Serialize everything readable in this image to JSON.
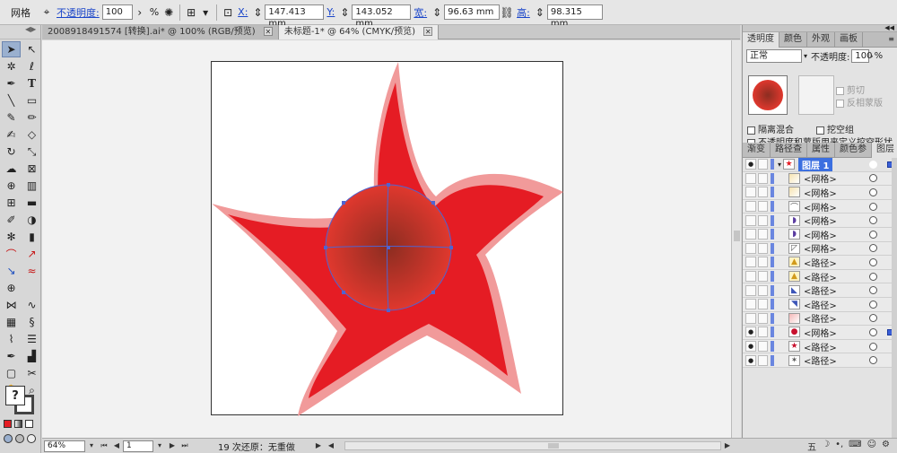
{
  "colors": {
    "star_outer": "#f19a9a",
    "star_inner": "#e51c24",
    "radial_center": "#8c2d21",
    "radial_edge": "#e0382e",
    "selection": "#5063d0",
    "layer_highlight": "#3b6fe0"
  },
  "control_bar": {
    "tool_name": "网格",
    "opacity_label": "不透明度:",
    "opacity_value": "100",
    "opacity_unit": "%",
    "x_label": "X:",
    "x_value": "147.413 mm",
    "y_label": "Y:",
    "y_value": "143.052 mm",
    "w_label": "宽:",
    "w_value": "96.63 mm",
    "h_label": "高:",
    "h_value": "98.315 mm"
  },
  "doc_tabs": [
    {
      "label": "2008918491574 [转换].ai* @ 100% (RGB/预览)",
      "active": false
    },
    {
      "label": "未标题-1* @ 64% (CMYK/预览)",
      "active": true
    }
  ],
  "tools": [
    "selection-tool",
    "direct-select-tool",
    "magic-wand-tool",
    "lasso-tool",
    "pen-tool",
    "type-tool",
    "line-tool",
    "rectangle-tool",
    "paintbrush-tool",
    "pencil-tool",
    "blob-brush-tool",
    "eraser-tool",
    "rotate-tool",
    "scale-tool",
    "warp-tool",
    "free-transform-tool",
    "shape-builder-tool",
    "perspective-tool",
    "mesh-tool",
    "gradient-tool",
    "eyedropper-tool",
    "blend-tool",
    "symbol-sprayer-tool",
    "column-graph-tool",
    "artboard-tool",
    "slice-tool",
    "hand-tool",
    "zoom-tool"
  ],
  "status_bar": {
    "zoom": "64%",
    "page": "1",
    "status": "19 次还原：无重做"
  },
  "transparency_panel": {
    "tabs": [
      "透明度",
      "颜色",
      "外观",
      "画板"
    ],
    "blend_mode": "正常",
    "opacity_label": "不透明度:",
    "opacity_value": "100",
    "opacity_unit": "%",
    "clip_label": "剪切",
    "invert_label": "反相蒙版",
    "isolate_label": "隔离混合",
    "knockout_label": "挖空组",
    "opacity_mask_label": "不透明度和蒙版用来定义挖空形状"
  },
  "layers_panel": {
    "tabs": [
      "渐变",
      "路径查",
      "属性",
      "颜色参",
      "图层"
    ],
    "layer_name": "图层 1",
    "items": [
      {
        "name": "<网格>",
        "eye": false,
        "thumb": "gradient-tan"
      },
      {
        "name": "<网格>",
        "eye": false,
        "thumb": "gradient-tan"
      },
      {
        "name": "<网格>",
        "eye": false,
        "thumb": "curve"
      },
      {
        "name": "<网格>",
        "eye": false,
        "thumb": "purple-shape"
      },
      {
        "name": "<网格>",
        "eye": false,
        "thumb": "purple-shape"
      },
      {
        "name": "<网格>",
        "eye": false,
        "thumb": "shape"
      },
      {
        "name": "<路径>",
        "eye": false,
        "thumb": "yellow"
      },
      {
        "name": "<路径>",
        "eye": false,
        "thumb": "yellow"
      },
      {
        "name": "<路径>",
        "eye": false,
        "thumb": "blue-purple"
      },
      {
        "name": "<路径>",
        "eye": false,
        "thumb": "blue"
      },
      {
        "name": "<路径>",
        "eye": false,
        "thumb": "red-small"
      },
      {
        "name": "<网格>",
        "eye": true,
        "thumb": "red-circle",
        "selected": true
      },
      {
        "name": "<路径>",
        "eye": true,
        "thumb": "red-star"
      },
      {
        "name": "<路径>",
        "eye": true,
        "thumb": "pink-star"
      }
    ]
  }
}
